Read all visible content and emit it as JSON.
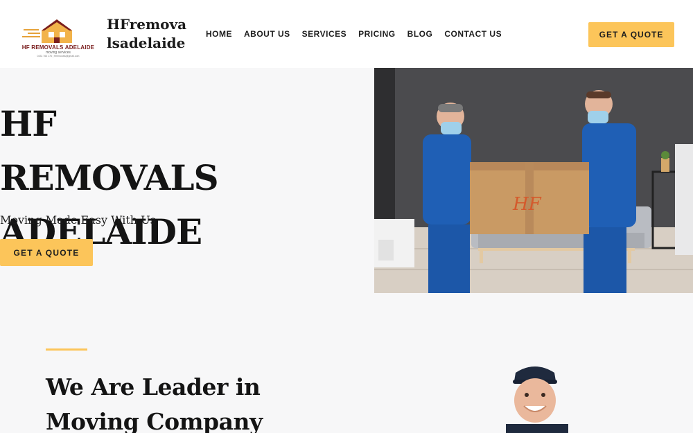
{
  "header": {
    "logo": {
      "name": "HF REMOVALS ADELAIDE",
      "subtitle": "moving services",
      "contact": "0431 764 176 | hfremovals@gmail.com",
      "icon": "house-icon"
    },
    "site_title": "HFremova lsadelaide",
    "nav": [
      "HOME",
      "ABOUT US",
      "SERVICES",
      "PRICING",
      "BLOG",
      "CONTACT US"
    ],
    "cta_label": "GET A QUOTE"
  },
  "hero": {
    "title_line1": "HF REMOVALS",
    "title_line2": "ADELAIDE",
    "subtitle": "Moving Made Easy With Us",
    "cta_label": "GET A QUOTE",
    "image_box_text": "HF"
  },
  "about": {
    "title_line1": "We Are Leader in",
    "title_line2": "Moving Company"
  },
  "colors": {
    "accent": "#fcc55a",
    "page_bg": "#f7f7f8",
    "header_bg": "#ffffff",
    "text": "#141414"
  }
}
